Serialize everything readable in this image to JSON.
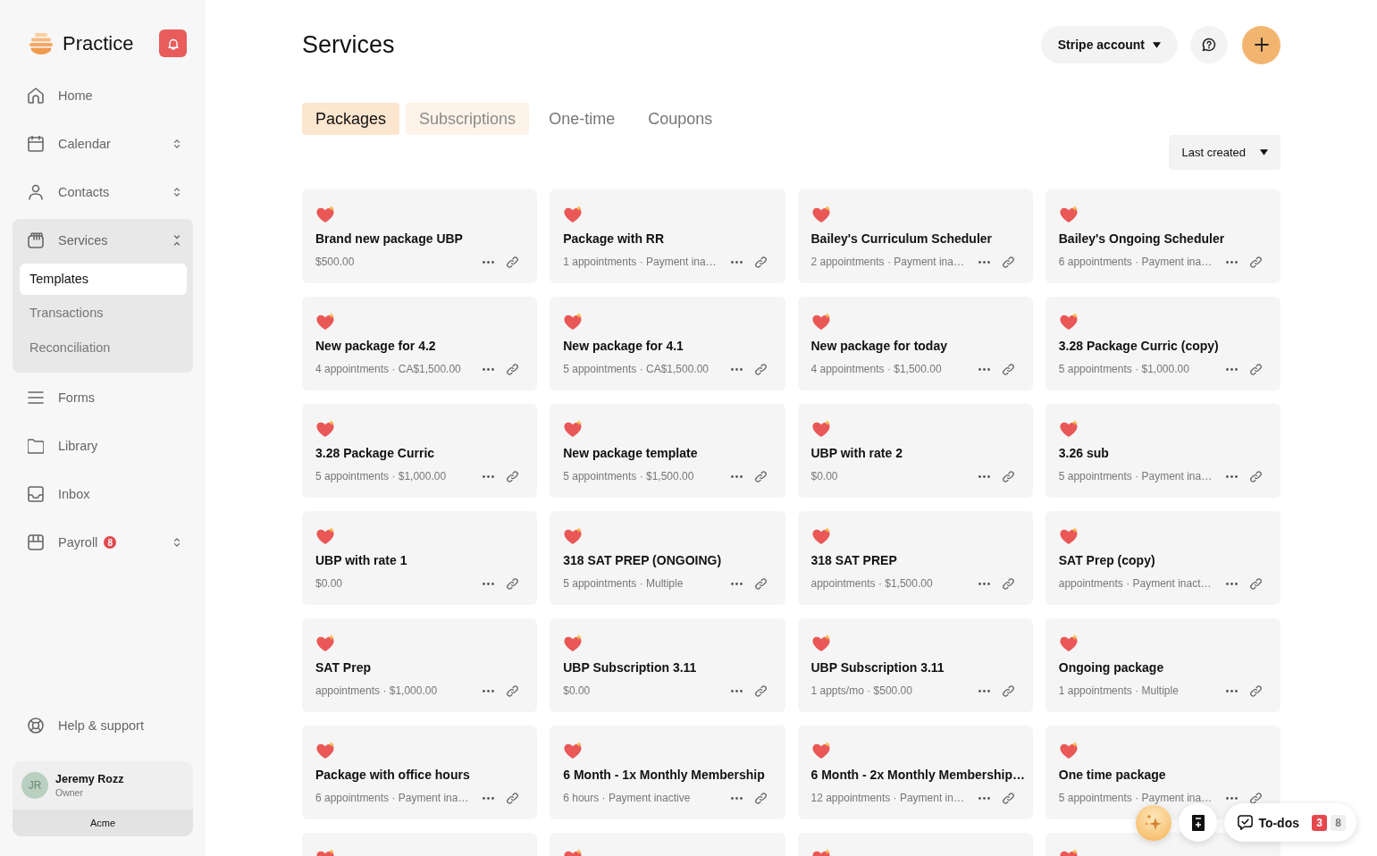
{
  "sidebar": {
    "brand": "Practice",
    "nav": [
      {
        "label": "Home",
        "kind": "link"
      },
      {
        "label": "Calendar",
        "kind": "group",
        "expanded": false
      },
      {
        "label": "Contacts",
        "kind": "group",
        "expanded": false
      },
      {
        "label": "Services",
        "kind": "group",
        "expanded": true,
        "children": [
          {
            "label": "Templates",
            "selected": true
          },
          {
            "label": "Transactions",
            "selected": false
          },
          {
            "label": "Reconciliation",
            "selected": false
          }
        ]
      },
      {
        "label": "Forms",
        "kind": "link"
      },
      {
        "label": "Library",
        "kind": "link"
      },
      {
        "label": "Inbox",
        "kind": "link"
      },
      {
        "label": "Payroll",
        "kind": "group",
        "expanded": false,
        "badge": "8"
      }
    ],
    "help": "Help & support",
    "user": {
      "initials": "JR",
      "name": "Jeremy Rozz",
      "role": "Owner",
      "org": "Acme"
    }
  },
  "header": {
    "title": "Services",
    "account_button": "Stripe account"
  },
  "tabs": [
    {
      "label": "Packages",
      "selected": true,
      "hovered": false
    },
    {
      "label": "Subscriptions",
      "selected": false,
      "hovered": true
    },
    {
      "label": "One-time",
      "selected": false,
      "hovered": false
    },
    {
      "label": "Coupons",
      "selected": false,
      "hovered": false
    }
  ],
  "sort": "Last created",
  "cards": [
    {
      "kind": "full",
      "title": "Brand new package UBP",
      "meta": "$500.00"
    },
    {
      "kind": "full",
      "title": "Package with RR",
      "meta": "1 appointments · Payment ina…"
    },
    {
      "kind": "full",
      "title": "Bailey's Curriculum Scheduler",
      "meta": "2 appointments · Payment ina…"
    },
    {
      "kind": "full",
      "title": "Bailey's Ongoing Scheduler",
      "meta": "6 appointments · Payment ina…"
    },
    {
      "kind": "full",
      "title": "New package for 4.2",
      "meta": "4 appointments · CA$1,500.00"
    },
    {
      "kind": "full",
      "title": "New package for 4.1",
      "meta": "5 appointments · CA$1,500.00"
    },
    {
      "kind": "full",
      "title": "New package for today",
      "meta": "4 appointments · $1,500.00"
    },
    {
      "kind": "full",
      "title": "3.28 Package Curric (copy)",
      "meta": "5 appointments · $1,000.00"
    },
    {
      "kind": "full",
      "title": "3.28 Package Curric",
      "meta": "5 appointments · $1,000.00"
    },
    {
      "kind": "full",
      "title": "New package template",
      "meta": "5 appointments · $1,500.00"
    },
    {
      "kind": "full",
      "title": "UBP with rate 2",
      "meta": "$0.00"
    },
    {
      "kind": "full",
      "title": "3.26 sub",
      "meta": "5 appointments · Payment ina…"
    },
    {
      "kind": "full",
      "title": "UBP with rate 1",
      "meta": "$0.00"
    },
    {
      "kind": "full",
      "title": "318 SAT PREP (ONGOING)",
      "meta": "5 appointments · Multiple"
    },
    {
      "kind": "full",
      "title": "318 SAT PREP",
      "meta": "appointments · $1,500.00"
    },
    {
      "kind": "full",
      "title": "SAT Prep (copy)",
      "meta": "appointments · Payment inact…"
    },
    {
      "kind": "full",
      "title": "SAT Prep",
      "meta": "appointments · $1,000.00"
    },
    {
      "kind": "full",
      "title": "UBP Subscription 3.11",
      "meta": "$0.00"
    },
    {
      "kind": "full",
      "title": "UBP Subscription 3.11",
      "meta": "1 appts/mo · $500.00"
    },
    {
      "kind": "full",
      "title": "Ongoing package",
      "meta": "1 appointments · Multiple"
    },
    {
      "kind": "full",
      "title": "Package with office hours",
      "meta": "6 appointments · Payment ina…"
    },
    {
      "kind": "full",
      "title": "6 Month - 1x Monthly Membership",
      "meta": "6 hours · Payment inactive"
    },
    {
      "kind": "full",
      "title": "6 Month - 2x Monthly Membership…",
      "meta": "12 appointments · Payment in…"
    },
    {
      "kind": "full",
      "title": "One time package",
      "meta": "5 appointments · Payment ina…"
    },
    {
      "kind": "cut"
    },
    {
      "kind": "cut"
    },
    {
      "kind": "cut"
    },
    {
      "kind": "cut"
    }
  ],
  "todos": {
    "label": "To-dos",
    "counts": [
      {
        "value": "3",
        "color": "#e5484d"
      },
      {
        "value": "8",
        "color": "#efefef"
      }
    ]
  }
}
